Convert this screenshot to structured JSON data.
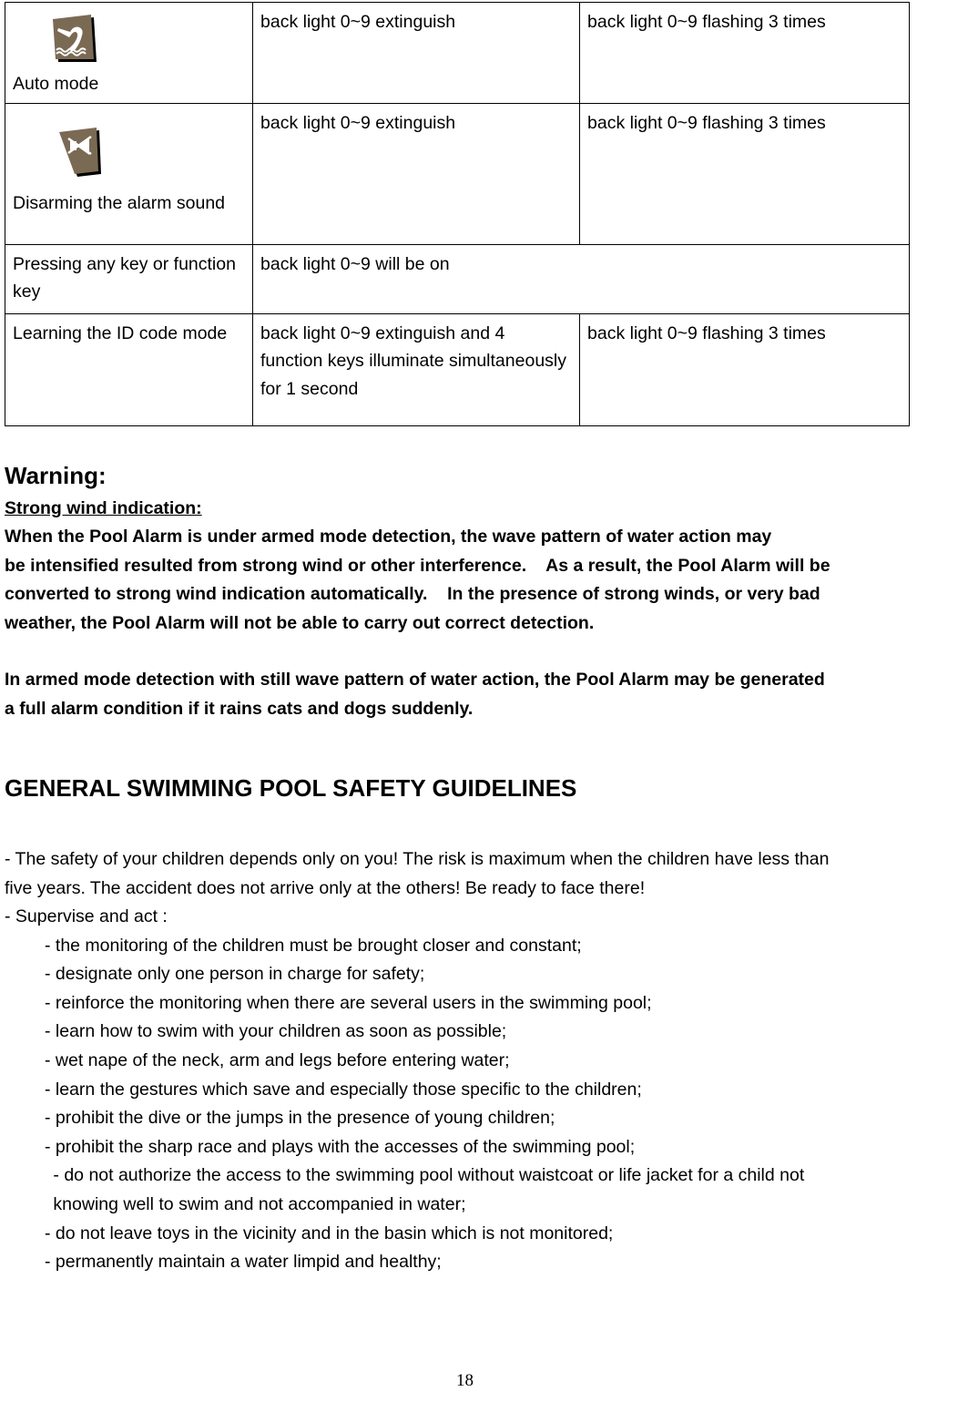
{
  "table": {
    "rows": [
      {
        "mode_icon": "diver-over-water-icon",
        "mode_label": "Auto mode",
        "armed_state": "back light 0~9 extinguish",
        "alarm_state": "back light 0~9 flashing 3 times",
        "merged": false
      },
      {
        "mode_icon": "muted-speaker-icon",
        "mode_label": "Disarming the alarm sound",
        "armed_state": "back light 0~9 extinguish",
        "alarm_state": "back light 0~9 flashing 3 times",
        "merged": false
      },
      {
        "mode_icon": null,
        "mode_label": "Pressing any key or function key",
        "armed_state": "back light 0~9 will be on",
        "alarm_state": "",
        "merged": true
      },
      {
        "mode_icon": null,
        "mode_label": "Learning the ID code mode",
        "armed_state": "back light 0~9 extinguish and 4 function keys illuminate simultaneously for 1 second",
        "alarm_state": "back light 0~9 flashing 3 times",
        "merged": false
      }
    ]
  },
  "warning": {
    "title": "Warning:",
    "subhead": "Strong wind indication: ",
    "paragraph1": "When the Pool Alarm is under armed mode detection, the wave pattern of water action may\nbe intensified resulted from strong wind or other interference.    As a result, the Pool Alarm will be\nconverted to strong wind indication automatically.    In the presence of strong winds, or very bad\nweather, the Pool Alarm will not be able to carry out correct detection.",
    "paragraph2": "In armed mode detection with still wave pattern of water action, the Pool Alarm may be generated\na full alarm condition if it rains cats and dogs suddenly."
  },
  "section": {
    "heading": "GENERAL SWIMMING POOL SAFETY GUIDELINES"
  },
  "guidelines": {
    "intro": "- The safety of your children depends only on you! The risk is maximum when the children have less than\nfive years. The accident does not arrive only at the others! Be ready to face there!",
    "supervise": "- Supervise and act :",
    "items": [
      "- the monitoring of the children must be brought closer and constant;",
      "- designate only one person in charge for safety;",
      "- reinforce the monitoring when there are several users in the swimming pool;",
      "- learn how to swim with your children as soon as possible;",
      "- wet nape of the neck, arm and legs before entering water;",
      "- learn the gestures which save and especially those specific to the children;",
      "- prohibit the dive or the jumps in the presence of young children;",
      "- prohibit the sharp race and plays with the accesses of the swimming pool;"
    ],
    "item_wrapped": " - do not authorize the access to the swimming pool without waistcoat or life jacket for a child not\n knowing well to swim and not accompanied in water;",
    "items_tail": [
      "- do not leave toys in the vicinity and in the basin which is not monitored;",
      "- permanently maintain a water limpid and healthy;"
    ]
  },
  "footer": {
    "page_number": "18"
  },
  "colors": {
    "icon_brown": "#7a6a54",
    "icon_glyph": "#ffffff",
    "border": "#000000",
    "text": "#000000",
    "background": "#ffffff"
  }
}
